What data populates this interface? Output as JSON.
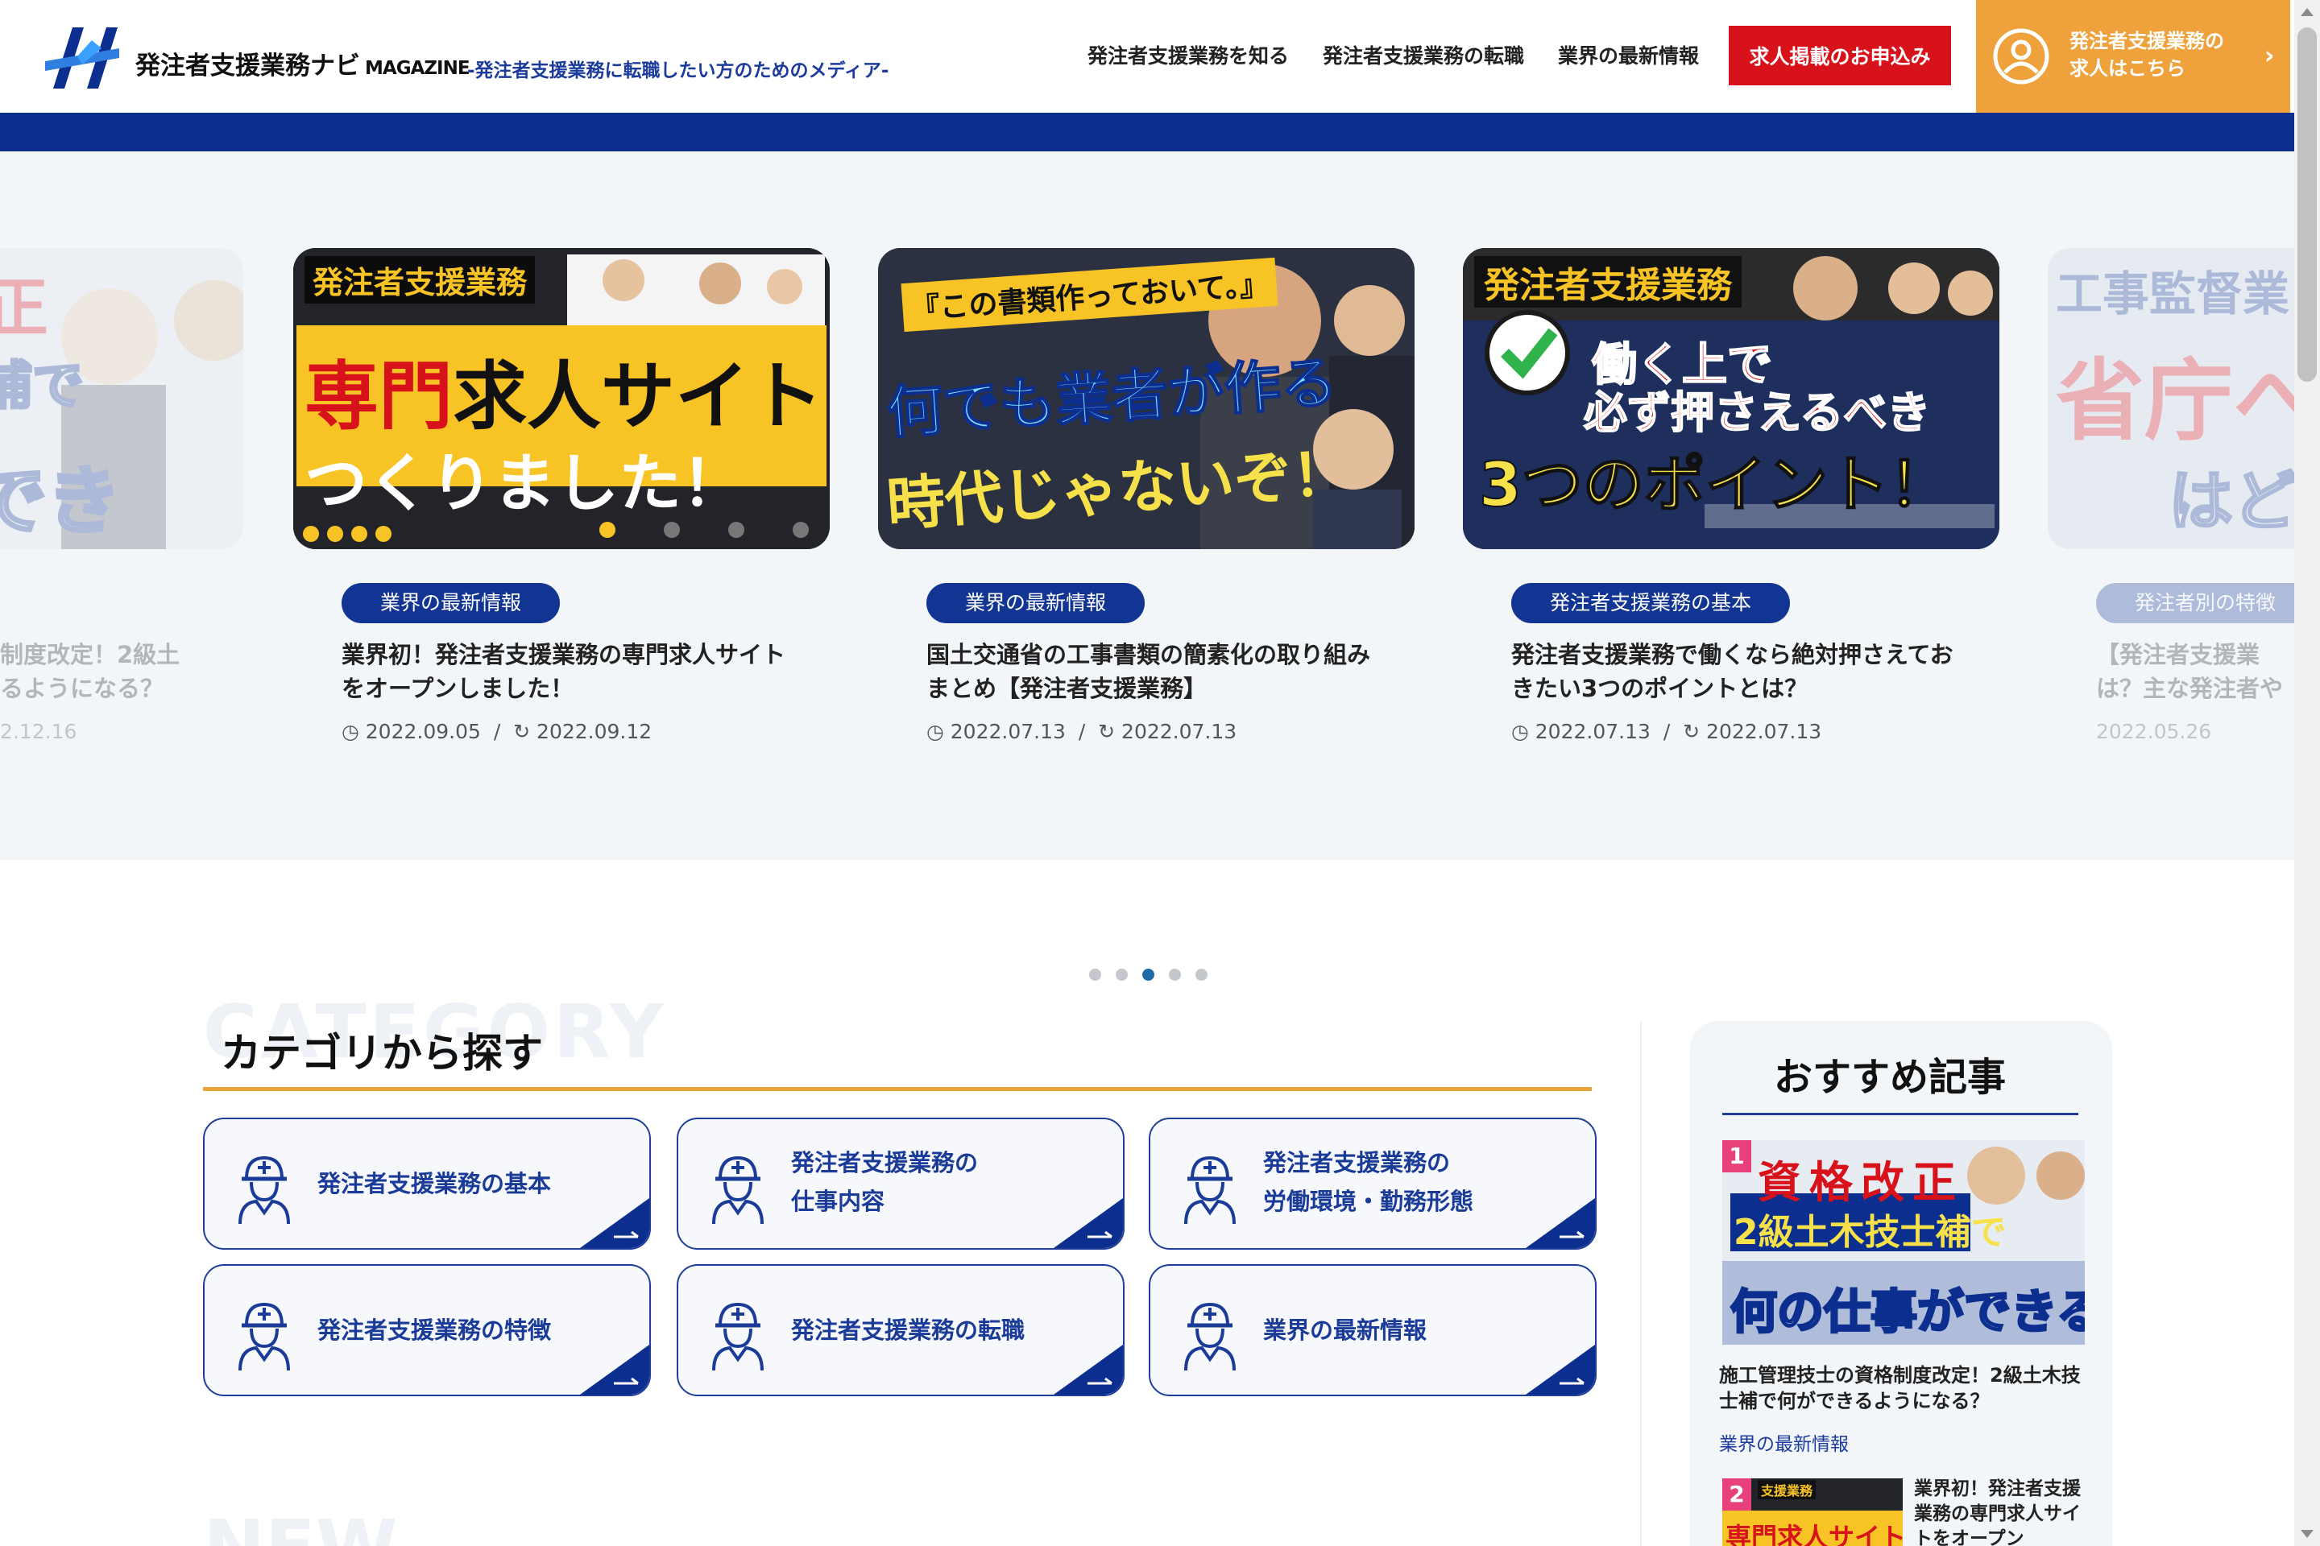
{
  "header": {
    "logo_title": "発注者支援業務ナビ",
    "logo_sub": "MAGAZINE",
    "tagline": "-発注者支援業務に転職したい方のためのメディア-",
    "nav": [
      "発注者支援業務を知る",
      "発注者支援業務の転職",
      "業界の最新情報"
    ],
    "cta_red": "求人掲載のお申込み",
    "cta_orange_line1": "発注者支援業務の",
    "cta_orange_line2": "求人はこちら",
    "colors": {
      "navy": "#0c2f8f",
      "red": "#d8121b",
      "orange": "#efa23c"
    }
  },
  "carousel": {
    "cards": [
      {
        "tag": "",
        "title": "制度改定！2級土\nるようになる？",
        "published": "2.12.16",
        "updated": "",
        "thumb": {
          "line1": "正",
          "line2": "補で",
          "line3": "できる？"
        }
      },
      {
        "tag": "業界の最新情報",
        "title": "業界初！発注者支援業務の専門求人サイトをオープンしました！",
        "published": "2022.09.05",
        "updated": "2022.09.12",
        "thumb": {
          "banner": "発注者支援業務",
          "big1": "専門",
          "big2": "求人サイト",
          "big3": "つくりました！"
        }
      },
      {
        "tag": "業界の最新情報",
        "title": "国土交通省の工事書類の簡素化の取り組みまとめ【発注者支援業務】",
        "published": "2022.07.13",
        "updated": "2022.07.13",
        "thumb": {
          "quote": "『この書類作っておいて。』",
          "big1": "何でも業者が作る",
          "big2": "時代じゃないぞ！"
        }
      },
      {
        "tag": "発注者支援業務の基本",
        "title": "発注者支援業務で働くなら絶対押さえておきたい3つのポイントとは？",
        "published": "2022.07.13",
        "updated": "2022.07.13",
        "thumb": {
          "banner": "発注者支援業務",
          "big1": "働く上で",
          "big2": "必ず押さえるべき",
          "big3": "3つのポイント！"
        }
      },
      {
        "tag": "発注者別の特徴",
        "title": "【発注者支援業\nは？主な発注者や",
        "published": "2022.05.26",
        "updated": "",
        "thumb": {
          "line1": "工事監督業",
          "line2": "省庁へ",
          "line3": "はど"
        }
      }
    ],
    "dots": 5,
    "active_dot": 2
  },
  "category": {
    "bg_word": "CATEGORY",
    "title": "カテゴリから探す",
    "items": [
      {
        "label": "発注者支援業務の基本"
      },
      {
        "label": "発注者支援業務の\n仕事内容"
      },
      {
        "label": "発注者支援業務の\n労働環境・勤務形態"
      },
      {
        "label": "発注者支援業務の特徴"
      },
      {
        "label": "発注者支援業務の転職"
      },
      {
        "label": "業界の最新情報"
      }
    ]
  },
  "sidebar": {
    "title": "おすすめ記事",
    "rank1": {
      "num": "1",
      "thumb_top": "資格改正",
      "thumb_mid": "2級土木技士補で",
      "thumb_bot": "何の仕事ができる？",
      "title": "施工管理技士の資格制度改定！2級土木技士補で何ができるようになる？",
      "category": "業界の最新情報"
    },
    "rank2": {
      "num": "2",
      "thumb_top": "支援業務",
      "thumb_bot": "専門求人サイト",
      "title": "業界初！発注者支援業務の専門求人サイトをオープン"
    }
  },
  "new_section": {
    "bg_word": "NEW"
  }
}
